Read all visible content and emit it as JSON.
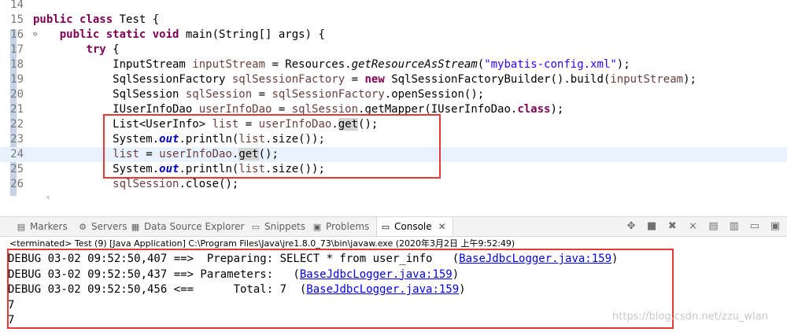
{
  "editor": {
    "lines": [
      {
        "n": "14",
        "segs": []
      },
      {
        "n": "15",
        "segs": [
          {
            "c": "kw",
            "t": "public class"
          },
          {
            "c": "code",
            "t": " Test {"
          }
        ]
      },
      {
        "n": "16",
        "fold": "⊖",
        "segs": [
          {
            "c": "code",
            "t": "    "
          },
          {
            "c": "kw",
            "t": "public static void"
          },
          {
            "c": "code",
            "t": " main(String[] args) {"
          }
        ]
      },
      {
        "n": "17",
        "segs": [
          {
            "c": "code",
            "t": "        "
          },
          {
            "c": "kw",
            "t": "try"
          },
          {
            "c": "code",
            "t": " {"
          }
        ]
      },
      {
        "n": "18",
        "segs": [
          {
            "c": "code",
            "t": "            InputStream "
          },
          {
            "c": "var",
            "t": "inputStream"
          },
          {
            "c": "code",
            "t": " = Resources."
          },
          {
            "c": "meth",
            "t": "getResourceAsStream"
          },
          {
            "c": "code",
            "t": "("
          },
          {
            "c": "str",
            "t": "\"mybatis-config.xml\""
          },
          {
            "c": "code",
            "t": ");"
          }
        ]
      },
      {
        "n": "19",
        "segs": [
          {
            "c": "code",
            "t": "            SqlSessionFactory "
          },
          {
            "c": "var",
            "t": "sqlSessionFactory"
          },
          {
            "c": "code",
            "t": " = "
          },
          {
            "c": "kw",
            "t": "new"
          },
          {
            "c": "code",
            "t": " SqlSessionFactoryBuilder().build("
          },
          {
            "c": "var",
            "t": "inputStream"
          },
          {
            "c": "code",
            "t": ");"
          }
        ]
      },
      {
        "n": "20",
        "segs": [
          {
            "c": "code",
            "t": "            SqlSession "
          },
          {
            "c": "var",
            "t": "sqlSession"
          },
          {
            "c": "code",
            "t": " = "
          },
          {
            "c": "var",
            "t": "sqlSessionFactory"
          },
          {
            "c": "code",
            "t": ".openSession();"
          }
        ]
      },
      {
        "n": "21",
        "segs": [
          {
            "c": "code",
            "t": "            IUserInfoDao "
          },
          {
            "c": "var",
            "t": "userInfoDao"
          },
          {
            "c": "code",
            "t": " = "
          },
          {
            "c": "var",
            "t": "sqlSession"
          },
          {
            "c": "code",
            "t": ".getMapper(IUserInfoDao."
          },
          {
            "c": "kw",
            "t": "class"
          },
          {
            "c": "code",
            "t": ");"
          }
        ]
      },
      {
        "n": "22",
        "segs": [
          {
            "c": "code",
            "t": "            List<UserInfo> "
          },
          {
            "c": "var",
            "t": "list"
          },
          {
            "c": "code",
            "t": " = "
          },
          {
            "c": "var",
            "t": "userInfoDao"
          },
          {
            "c": "code",
            "t": "."
          },
          {
            "c": "hl-word",
            "t": "get"
          },
          {
            "c": "code",
            "t": "();"
          }
        ]
      },
      {
        "n": "23",
        "segs": [
          {
            "c": "code",
            "t": "            System."
          },
          {
            "c": "stat",
            "t": "out"
          },
          {
            "c": "code",
            "t": ".println("
          },
          {
            "c": "var",
            "t": "list"
          },
          {
            "c": "code",
            "t": ".size());"
          }
        ]
      },
      {
        "n": "24",
        "current": true,
        "segs": [
          {
            "c": "code",
            "t": "            "
          },
          {
            "c": "var",
            "t": "list"
          },
          {
            "c": "code",
            "t": " = "
          },
          {
            "c": "var",
            "t": "userInfoDao"
          },
          {
            "c": "code",
            "t": "."
          },
          {
            "c": "hl-word",
            "t": "get"
          },
          {
            "c": "code",
            "t": "();"
          }
        ]
      },
      {
        "n": "25",
        "segs": [
          {
            "c": "code",
            "t": "            System."
          },
          {
            "c": "stat",
            "t": "out"
          },
          {
            "c": "code",
            "t": ".println("
          },
          {
            "c": "var",
            "t": "list"
          },
          {
            "c": "code",
            "t": ".size());"
          }
        ]
      },
      {
        "n": "26",
        "segs": [
          {
            "c": "code",
            "t": "            "
          },
          {
            "c": "var",
            "t": "sqlSession"
          },
          {
            "c": "code",
            "t": ".close();"
          }
        ]
      }
    ]
  },
  "tabs": [
    {
      "label": "Markers",
      "icon": "markers-icon",
      "glyph": "▤"
    },
    {
      "label": "Servers",
      "icon": "servers-icon",
      "glyph": "⚙"
    },
    {
      "label": "Data Source Explorer",
      "icon": "datasource-icon",
      "glyph": "▦"
    },
    {
      "label": "Snippets",
      "icon": "snippets-icon",
      "glyph": "▭"
    },
    {
      "label": "Problems",
      "icon": "problems-icon",
      "glyph": "▣"
    },
    {
      "label": "Console",
      "icon": "console-icon",
      "glyph": "▭",
      "active": true
    }
  ],
  "console": {
    "terminated": "<terminated> Test (9) [Java Application] C:\\Program Files\\Java\\jre1.8.0_73\\bin\\javaw.exe (2020年3月2日 上午9:52:49)",
    "lines": [
      {
        "text": "DEBUG 03-02 09:52:50,407 ==>  Preparing: SELECT * from user_info   (",
        "link": "BaseJdbcLogger.java:159",
        "tail": ")"
      },
      {
        "text": "DEBUG 03-02 09:52:50,437 ==> Parameters:   (",
        "link": "BaseJdbcLogger.java:159",
        "tail": ")"
      },
      {
        "text": "DEBUG 03-02 09:52:50,456 <==      Total: 7  (",
        "link": "BaseJdbcLogger.java:159",
        "tail": ")"
      },
      {
        "text": "7"
      },
      {
        "text": "7"
      }
    ]
  },
  "watermark": "https://blog.csdn.net/zzu_wlan"
}
